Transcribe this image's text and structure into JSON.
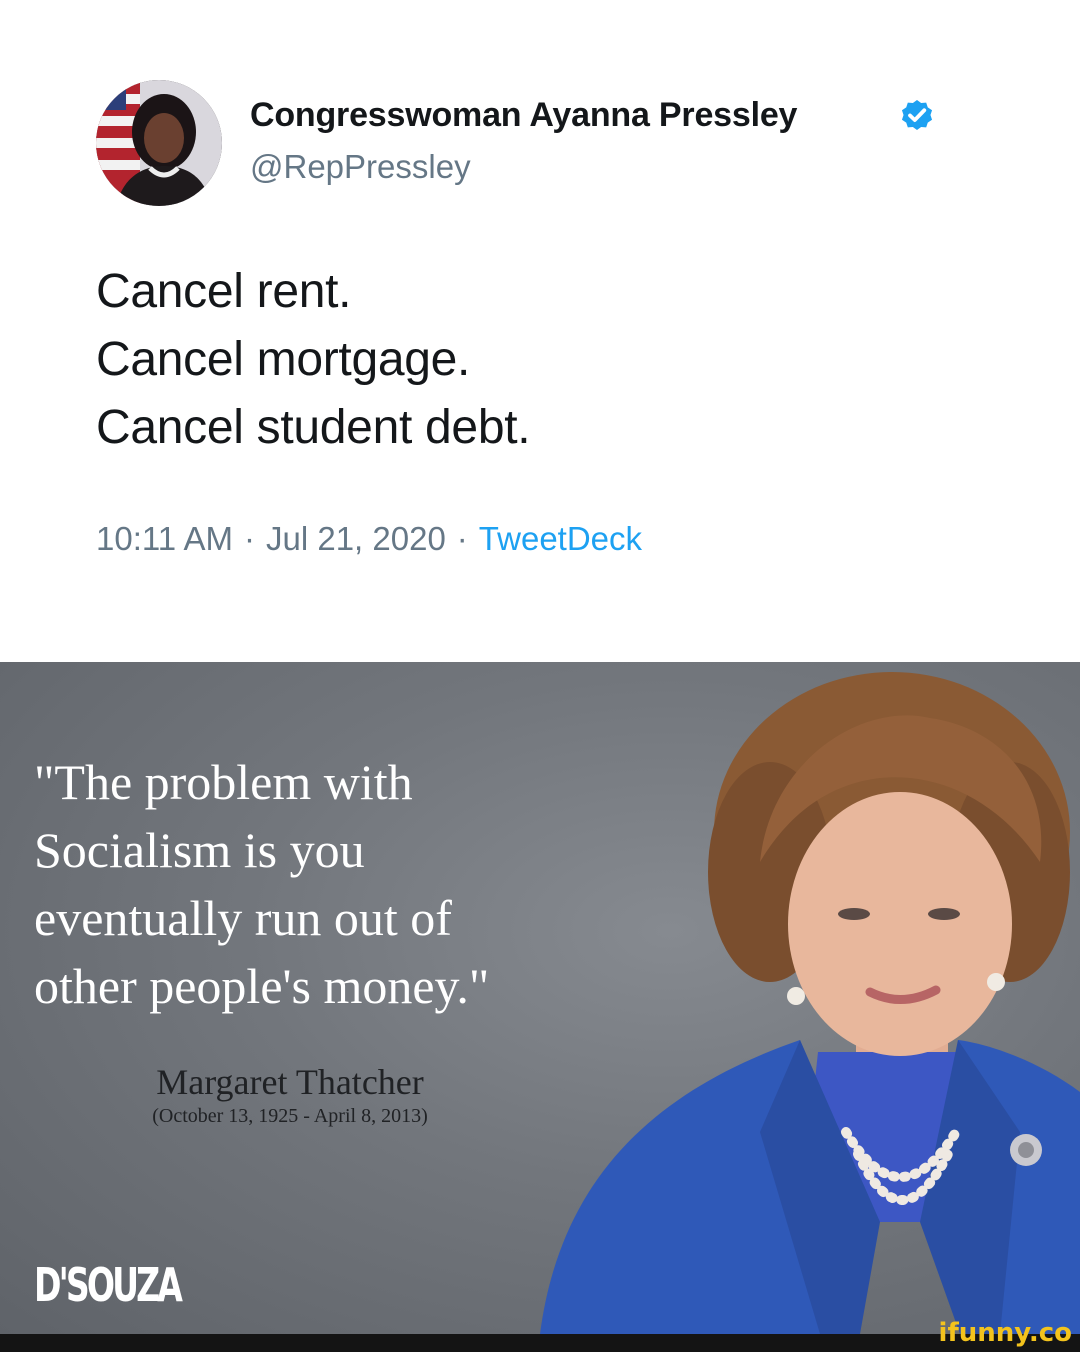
{
  "tweet": {
    "author_name": "Congresswoman Ayanna Pressley",
    "handle": "@RepPressley",
    "verified_icon": "verified-badge-icon",
    "lines": [
      "Cancel rent.",
      "Cancel mortgage.",
      "Cancel student debt."
    ],
    "time": "10:11 AM",
    "separator": "·",
    "date": "Jul 21, 2020",
    "source": "TweetDeck",
    "colors": {
      "text": "#14171a",
      "secondary": "#657786",
      "link": "#1da1f2"
    }
  },
  "poster": {
    "quote_lines": [
      "\"The problem with",
      "Socialism is you",
      "eventually run out of",
      "other people's money.\""
    ],
    "author_name": "Margaret Thatcher",
    "author_dates": "(October 13, 1925 - April 8, 2013)",
    "brand": "D'SOUZA"
  },
  "watermark": {
    "text": "ifunny.co",
    "color": "#f3c31d"
  }
}
